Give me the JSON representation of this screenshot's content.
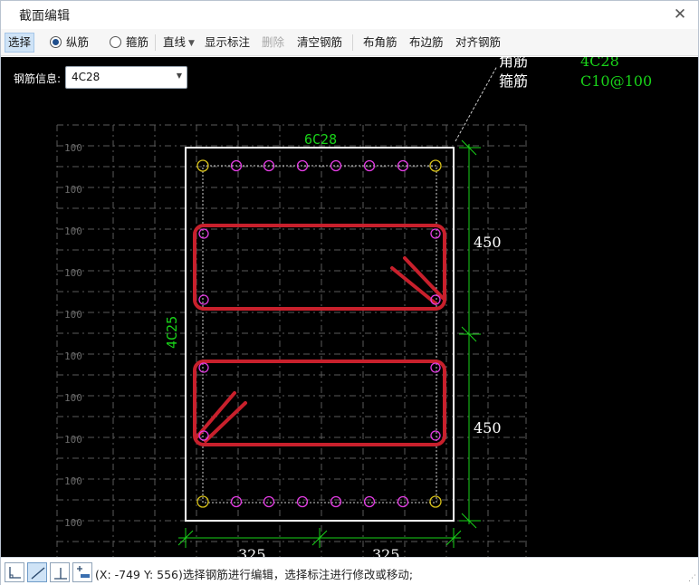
{
  "window": {
    "title": "截面编辑",
    "close_glyph": "✕"
  },
  "toolbar": {
    "select": "选择",
    "longitudinal": "纵筋",
    "stirrup": "箍筋",
    "line": "直线",
    "show_dims": "显示标注",
    "delete": "删除",
    "clear_rebar": "清空钢筋",
    "corner_rebar": "布角筋",
    "side_rebar": "布边筋",
    "align_rebar": "对齐钢筋"
  },
  "rebar_info": {
    "label": "钢筋信息:",
    "value": "4C28"
  },
  "legend": {
    "main_label": "角筋",
    "main_value": "4C28",
    "stirrup_label": "箍筋",
    "stirrup_value": "C10@100"
  },
  "drawing": {
    "top_rebar": "6C28",
    "side_rebar": "4C25",
    "dim_right_upper": "450",
    "dim_right_lower": "450",
    "dim_bottom_left": "325",
    "dim_bottom_right": "325",
    "grid_labels": [
      "100",
      "100",
      "100",
      "100",
      "100",
      "100",
      "100",
      "100",
      "100",
      "100"
    ]
  },
  "status": {
    "text": "(X: -749 Y: 556)选择钢筋进行编辑，选择标注进行修改或移动;"
  },
  "colors": {
    "canvas_bg": "#000000",
    "section_outline": "#ffffff",
    "dim_green": "#19d219",
    "stirrup_red": "#c8202c",
    "rebar_magenta": "#e23ce2",
    "corner_rebar_yellow": "#d8c21a",
    "grid_gray": "#5a5a5a"
  }
}
